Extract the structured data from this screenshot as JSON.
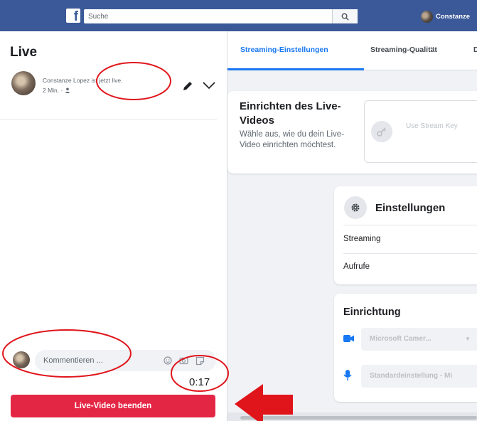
{
  "topbar": {
    "logo_letter": "f",
    "search_placeholder": "Suche",
    "user_name": "Constanze"
  },
  "left_panel": {
    "title": "Live",
    "post": {
      "author_text": "Constanze Lopez ist jetzt live.",
      "time": "2 Min. ·"
    },
    "comment_placeholder": "Kommentieren ...",
    "timer": "0:17",
    "end_button": "Live-Video beenden"
  },
  "tabs": [
    {
      "label": "Streaming-Einstellungen",
      "active": true
    },
    {
      "label": "Streaming-Qualität",
      "active": false
    },
    {
      "label": "D",
      "active": false
    }
  ],
  "setup_card": {
    "title": "Einrichten des Live-Videos",
    "description": "Wähle aus, wie du dein Live-Video einrichten möchtest.",
    "stream_key_label": "Use Stream Key"
  },
  "settings_card": {
    "title": "Einstellungen",
    "rows": [
      "Streaming",
      "Aufrufe"
    ]
  },
  "setup_card2": {
    "title": "Einrichtung",
    "camera_value": "Microsoft Camer...",
    "mic_value": "Standardeinstellung - Mi"
  },
  "colors": {
    "facebook_blue": "#3b5998",
    "accent_blue": "#1877f2",
    "end_button_red": "#e42645",
    "annotation_red": "#e0151b"
  },
  "icons": [
    "facebook-logo",
    "search-icon",
    "pencil-icon",
    "chevron-down-icon",
    "emoji-icon",
    "camera-icon",
    "sticker-icon",
    "key-icon",
    "gear-icon",
    "video-camera-icon",
    "microphone-icon",
    "red-arrow"
  ]
}
